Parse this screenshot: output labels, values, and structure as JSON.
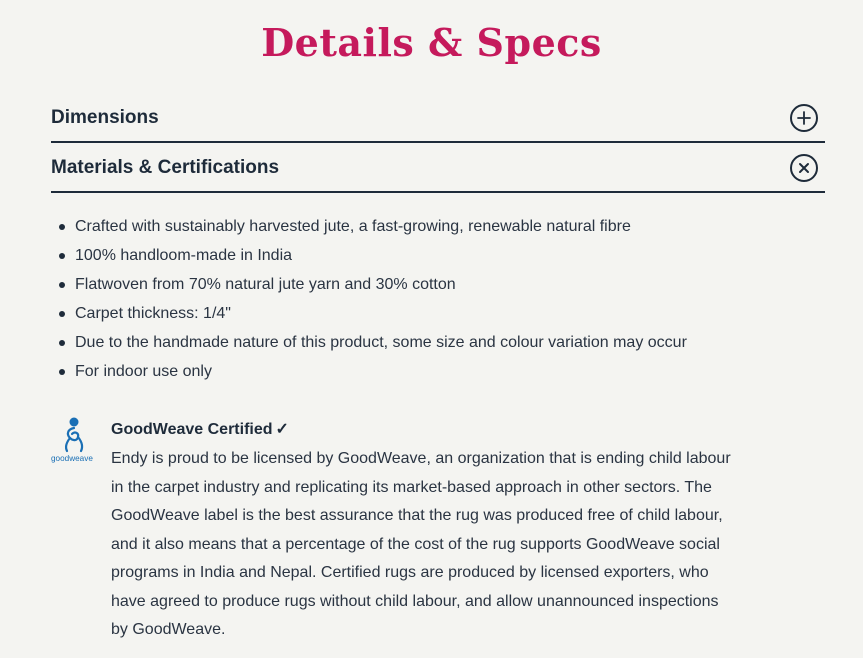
{
  "page": {
    "title": "Details & Specs"
  },
  "accordion": [
    {
      "label": "Dimensions",
      "state": "collapsed",
      "icon": "plus-icon"
    },
    {
      "label": "Materials & Certifications",
      "state": "expanded",
      "icon": "close-icon"
    }
  ],
  "specs": [
    "Crafted with sustainably harvested jute, a fast-growing, renewable natural fibre",
    "100% handloom-made in India",
    "Flatwoven from 70% natural jute yarn and 30% cotton",
    "Carpet thickness: 1/4\"",
    "Due to the handmade nature of this product, some size and colour variation may occur",
    "For indoor use only"
  ],
  "goodweave": {
    "logo_text": "goodweave",
    "title": "GoodWeave Certified",
    "check": "✓",
    "description": "Endy is proud to be licensed by GoodWeave, an organization that is ending child labour in the carpet industry and replicating its market-based approach in other sectors. The GoodWeave label is the best assurance that the rug was produced free of child labour, and it also means that a percentage of the cost of the rug supports GoodWeave social programs in India and Nepal. Certified rugs are produced by licensed exporters, who have agreed to produce rugs without child labour, and allow unannounced inspections by GoodWeave."
  },
  "colors": {
    "title": "#c51a5c",
    "text": "#1e2b3a",
    "background": "#f4f4f1",
    "logo": "#1a6fb5"
  }
}
